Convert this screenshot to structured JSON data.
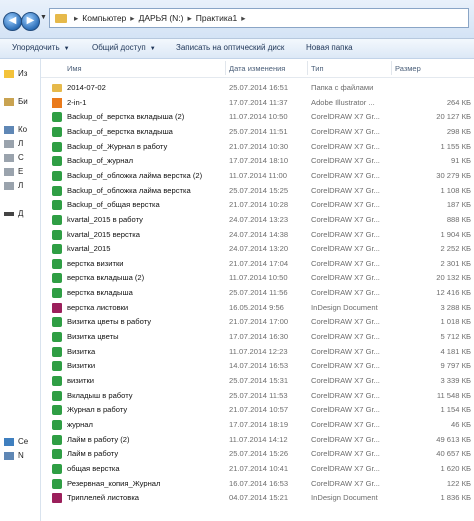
{
  "address": {
    "crumbs": [
      "Компьютер",
      "ДАРЬЯ (N:)",
      "Практика1"
    ]
  },
  "toolbar": {
    "organize": "Упорядочить",
    "share": "Общий доступ",
    "burn": "Записать на оптический диск",
    "new_folder": "Новая папка"
  },
  "nav": {
    "items": [
      "Из",
      "Би",
      "Ко",
      "Л",
      "С",
      "Е",
      "Л",
      "Д",
      "Се",
      "N"
    ]
  },
  "columns": {
    "name": "Имя",
    "date": "Дата изменения",
    "type": "Тип",
    "size": "Размер"
  },
  "files": [
    {
      "icon": "folder",
      "name": "2014-07-02",
      "date": "25.07.2014 16:51",
      "type": "Папка с файлами",
      "size": ""
    },
    {
      "icon": "ai",
      "name": "2-in-1",
      "date": "17.07.2014 11:37",
      "type": "Adobe Illustrator ...",
      "size": "264 КБ"
    },
    {
      "icon": "cdr",
      "name": "Backup_of_верстка вкладыша (2)",
      "date": "11.07.2014 10:50",
      "type": "CorelDRAW X7 Gr...",
      "size": "20 127 КБ"
    },
    {
      "icon": "cdr",
      "name": "Backup_of_верстка вкладыша",
      "date": "25.07.2014 11:51",
      "type": "CorelDRAW X7 Gr...",
      "size": "298 КБ"
    },
    {
      "icon": "cdr",
      "name": "Backup_of_Журнал в работу",
      "date": "21.07.2014 10:30",
      "type": "CorelDRAW X7 Gr...",
      "size": "1 155 КБ"
    },
    {
      "icon": "cdr",
      "name": "Backup_of_журнал",
      "date": "17.07.2014 18:10",
      "type": "CorelDRAW X7 Gr...",
      "size": "91 КБ"
    },
    {
      "icon": "cdr",
      "name": "Backup_of_обложка лайма верстка (2)",
      "date": "11.07.2014 11:00",
      "type": "CorelDRAW X7 Gr...",
      "size": "30 279 КБ"
    },
    {
      "icon": "cdr",
      "name": "Backup_of_обложка лайма верстка",
      "date": "25.07.2014 15:25",
      "type": "CorelDRAW X7 Gr...",
      "size": "1 108 КБ"
    },
    {
      "icon": "cdr",
      "name": "Backup_of_общая верстка",
      "date": "21.07.2014 10:28",
      "type": "CorelDRAW X7 Gr...",
      "size": "187 КБ"
    },
    {
      "icon": "cdr",
      "name": "kvartal_2015 в работу",
      "date": "24.07.2014 13:23",
      "type": "CorelDRAW X7 Gr...",
      "size": "888 КБ"
    },
    {
      "icon": "cdr",
      "name": "kvartal_2015 верстка",
      "date": "24.07.2014 14:38",
      "type": "CorelDRAW X7 Gr...",
      "size": "1 904 КБ"
    },
    {
      "icon": "cdr",
      "name": "kvartal_2015",
      "date": "24.07.2014 13:20",
      "type": "CorelDRAW X7 Gr...",
      "size": "2 252 КБ"
    },
    {
      "icon": "cdr",
      "name": "верстка визитки",
      "date": "21.07.2014 17:04",
      "type": "CorelDRAW X7 Gr...",
      "size": "2 301 КБ"
    },
    {
      "icon": "cdr",
      "name": "верстка вкладыша (2)",
      "date": "11.07.2014 10:50",
      "type": "CorelDRAW X7 Gr...",
      "size": "20 132 КБ"
    },
    {
      "icon": "cdr",
      "name": "верстка вкладыша",
      "date": "25.07.2014 11:56",
      "type": "CorelDRAW X7 Gr...",
      "size": "12 416 КБ"
    },
    {
      "icon": "indd",
      "name": "верстка листовки",
      "date": "16.05.2014 9:56",
      "type": "InDesign Document",
      "size": "3 288 КБ"
    },
    {
      "icon": "cdr",
      "name": "Визитка цветы в работу",
      "date": "21.07.2014 17:00",
      "type": "CorelDRAW X7 Gr...",
      "size": "1 018 КБ"
    },
    {
      "icon": "cdr",
      "name": "Визитка цветы",
      "date": "17.07.2014 16:30",
      "type": "CorelDRAW X7 Gr...",
      "size": "5 712 КБ"
    },
    {
      "icon": "cdr",
      "name": "Визитка",
      "date": "11.07.2014 12:23",
      "type": "CorelDRAW X7 Gr...",
      "size": "4 181 КБ"
    },
    {
      "icon": "cdr",
      "name": "Визитки",
      "date": "14.07.2014 16:53",
      "type": "CorelDRAW X7 Gr...",
      "size": "9 797 КБ"
    },
    {
      "icon": "cdr",
      "name": "визитки",
      "date": "25.07.2014 15:31",
      "type": "CorelDRAW X7 Gr...",
      "size": "3 339 КБ"
    },
    {
      "icon": "cdr",
      "name": "Вкладыш в работу",
      "date": "25.07.2014 11:53",
      "type": "CorelDRAW X7 Gr...",
      "size": "11 548 КБ"
    },
    {
      "icon": "cdr",
      "name": "Журнал в работу",
      "date": "21.07.2014 10:57",
      "type": "CorelDRAW X7 Gr...",
      "size": "1 154 КБ"
    },
    {
      "icon": "cdr",
      "name": "журнал",
      "date": "17.07.2014 18:19",
      "type": "CorelDRAW X7 Gr...",
      "size": "46 КБ"
    },
    {
      "icon": "cdr",
      "name": "Лайм в работу (2)",
      "date": "11.07.2014 14:12",
      "type": "CorelDRAW X7 Gr...",
      "size": "49 613 КБ"
    },
    {
      "icon": "cdr",
      "name": "Лайм в работу",
      "date": "25.07.2014 15:26",
      "type": "CorelDRAW X7 Gr...",
      "size": "40 657 КБ"
    },
    {
      "icon": "cdr",
      "name": "общая верстка",
      "date": "21.07.2014 10:41",
      "type": "CorelDRAW X7 Gr...",
      "size": "1 620 КБ"
    },
    {
      "icon": "cdr",
      "name": "Резервная_копия_Журнал",
      "date": "16.07.2014 16:53",
      "type": "CorelDRAW X7 Gr...",
      "size": "122 КБ"
    },
    {
      "icon": "indd",
      "name": "Триплелей листовка",
      "date": "04.07.2014 15:21",
      "type": "InDesign Document",
      "size": "1 836 КБ"
    }
  ]
}
